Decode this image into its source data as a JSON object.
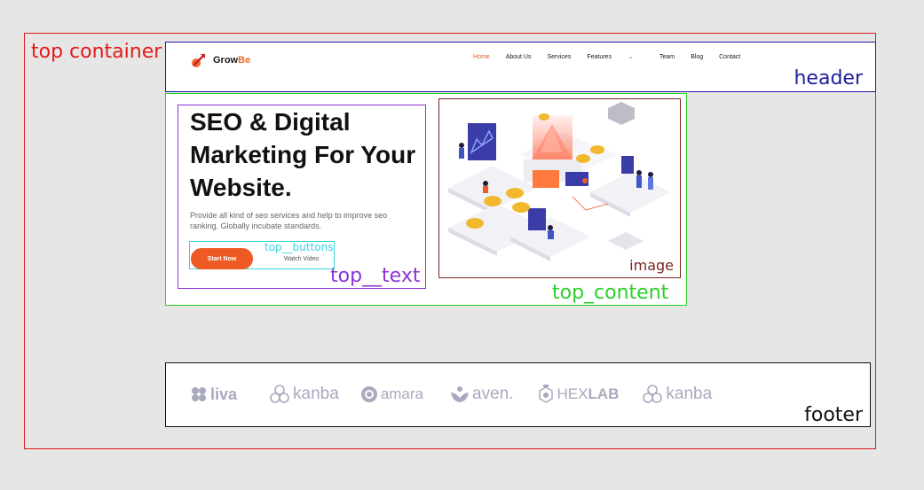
{
  "labels": {
    "top_container": "top container",
    "header": "header",
    "top_content": "top_content",
    "top_text": "top__text",
    "top_buttons": "top__buttons",
    "image": "image",
    "footer": "footer"
  },
  "header": {
    "logo_part1": "Grow",
    "logo_part2": "Be",
    "nav": {
      "home": "Home",
      "about": "About Us",
      "services": "Services",
      "features": "Features",
      "team": "Team",
      "blog": "Blog",
      "contact": "Contact"
    }
  },
  "hero": {
    "headline": "SEO & Digital Marketing For Your Website.",
    "description": "Provide all kind of seo services and help to improve seo ranking. Globally incubate standards.",
    "start_button": "Start Now",
    "watch_button": "Watch Video"
  },
  "footer": {
    "brands": [
      "liva",
      "kanba",
      "amara",
      "aven.",
      "HEX",
      "LAB",
      "kanba"
    ]
  },
  "colors": {
    "top_container": "#e21b1b",
    "header": "#1d1d9e",
    "top_content": "#2bd12b",
    "top_text": "#8a35d6",
    "top_buttons": "#39d6e0",
    "image": "#7b2323",
    "footer": "#111111",
    "accent": "#ef5a24",
    "brand_gray": "#a9a9bf"
  }
}
